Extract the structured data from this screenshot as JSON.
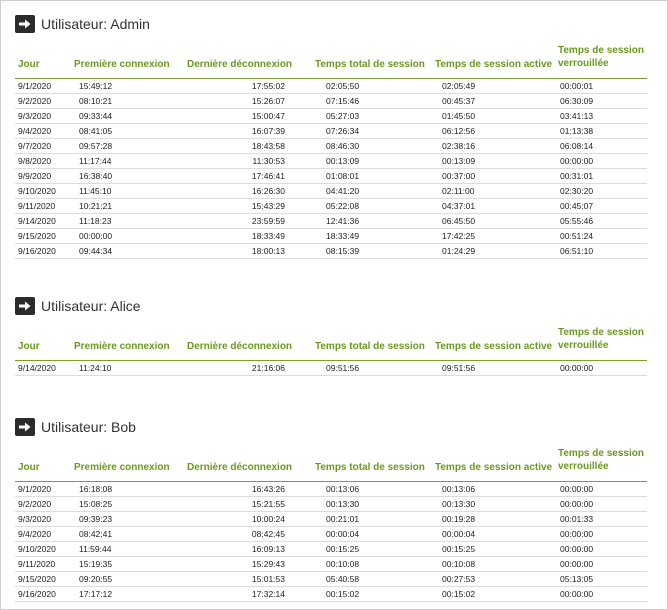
{
  "columns": [
    "Jour",
    "Première connexion",
    "Dernière déconnexion",
    "Temps total de session",
    "Temps de session active",
    "Temps de session verrouillée"
  ],
  "sections": [
    {
      "title": "Utilisateur: Admin",
      "rows": [
        [
          "9/1/2020",
          "15:49:12",
          "17:55:02",
          "02:05:50",
          "02:05:49",
          "00:00:01"
        ],
        [
          "9/2/2020",
          "08:10:21",
          "15:26:07",
          "07:15:46",
          "00:45:37",
          "06:30:09"
        ],
        [
          "9/3/2020",
          "09:33:44",
          "15:00:47",
          "05:27:03",
          "01:45:50",
          "03:41:13"
        ],
        [
          "9/4/2020",
          "08:41:05",
          "16:07:39",
          "07:26:34",
          "06:12:56",
          "01:13:38"
        ],
        [
          "9/7/2020",
          "09:57:28",
          "18:43:58",
          "08:46:30",
          "02:38:16",
          "06:08:14"
        ],
        [
          "9/8/2020",
          "11:17:44",
          "11:30:53",
          "00:13:09",
          "00:13:09",
          "00:00:00"
        ],
        [
          "9/9/2020",
          "16:38:40",
          "17:46:41",
          "01:08:01",
          "00:37:00",
          "00:31:01"
        ],
        [
          "9/10/2020",
          "11:45:10",
          "16:26:30",
          "04:41:20",
          "02:11:00",
          "02:30:20"
        ],
        [
          "9/11/2020",
          "10:21:21",
          "15:43:29",
          "05:22:08",
          "04:37:01",
          "00:45:07"
        ],
        [
          "9/14/2020",
          "11:18:23",
          "23:59:59",
          "12:41:36",
          "06:45:50",
          "05:55:46"
        ],
        [
          "9/15/2020",
          "00:00:00",
          "18:33:49",
          "18:33:49",
          "17:42:25",
          "00:51:24"
        ],
        [
          "9/16/2020",
          "09:44:34",
          "18:00:13",
          "08:15:39",
          "01:24:29",
          "06:51:10"
        ]
      ]
    },
    {
      "title": "Utilisateur: Alice",
      "rows": [
        [
          "9/14/2020",
          "11:24:10",
          "21:16:06",
          "09:51:56",
          "09:51:56",
          "00:00:00"
        ]
      ]
    },
    {
      "title": "Utilisateur: Bob",
      "rows": [
        [
          "9/1/2020",
          "16:18:08",
          "16:43:26",
          "00:13:06",
          "00:13:06",
          "00:00:00"
        ],
        [
          "9/2/2020",
          "15:08:25",
          "15:21:55",
          "00:13:30",
          "00:13:30",
          "00:00:00"
        ],
        [
          "9/3/2020",
          "09:39:23",
          "10:00:24",
          "00:21:01",
          "00:19:28",
          "00:01:33"
        ],
        [
          "9/4/2020",
          "08:42:41",
          "08:42:45",
          "00:00:04",
          "00:00:04",
          "00:00:00"
        ],
        [
          "9/10/2020",
          "11:59:44",
          "16:09:13",
          "00:15:25",
          "00:15:25",
          "00:00:00"
        ],
        [
          "9/11/2020",
          "15:19:35",
          "15:29:43",
          "00:10:08",
          "00:10:08",
          "00:00:00"
        ],
        [
          "9/15/2020",
          "09:20:55",
          "15:01:53",
          "05:40:58",
          "00:27:53",
          "05:13:05"
        ],
        [
          "9/16/2020",
          "17:17:12",
          "17:32:14",
          "00:15:02",
          "00:15:02",
          "00:00:00"
        ]
      ]
    }
  ],
  "colors": {
    "header_green": "#6a9a1f",
    "rule_green": "#7aa12a",
    "arrow_box": "#2b2b2b"
  },
  "icons": {
    "section_icon": "right-arrow-icon"
  }
}
